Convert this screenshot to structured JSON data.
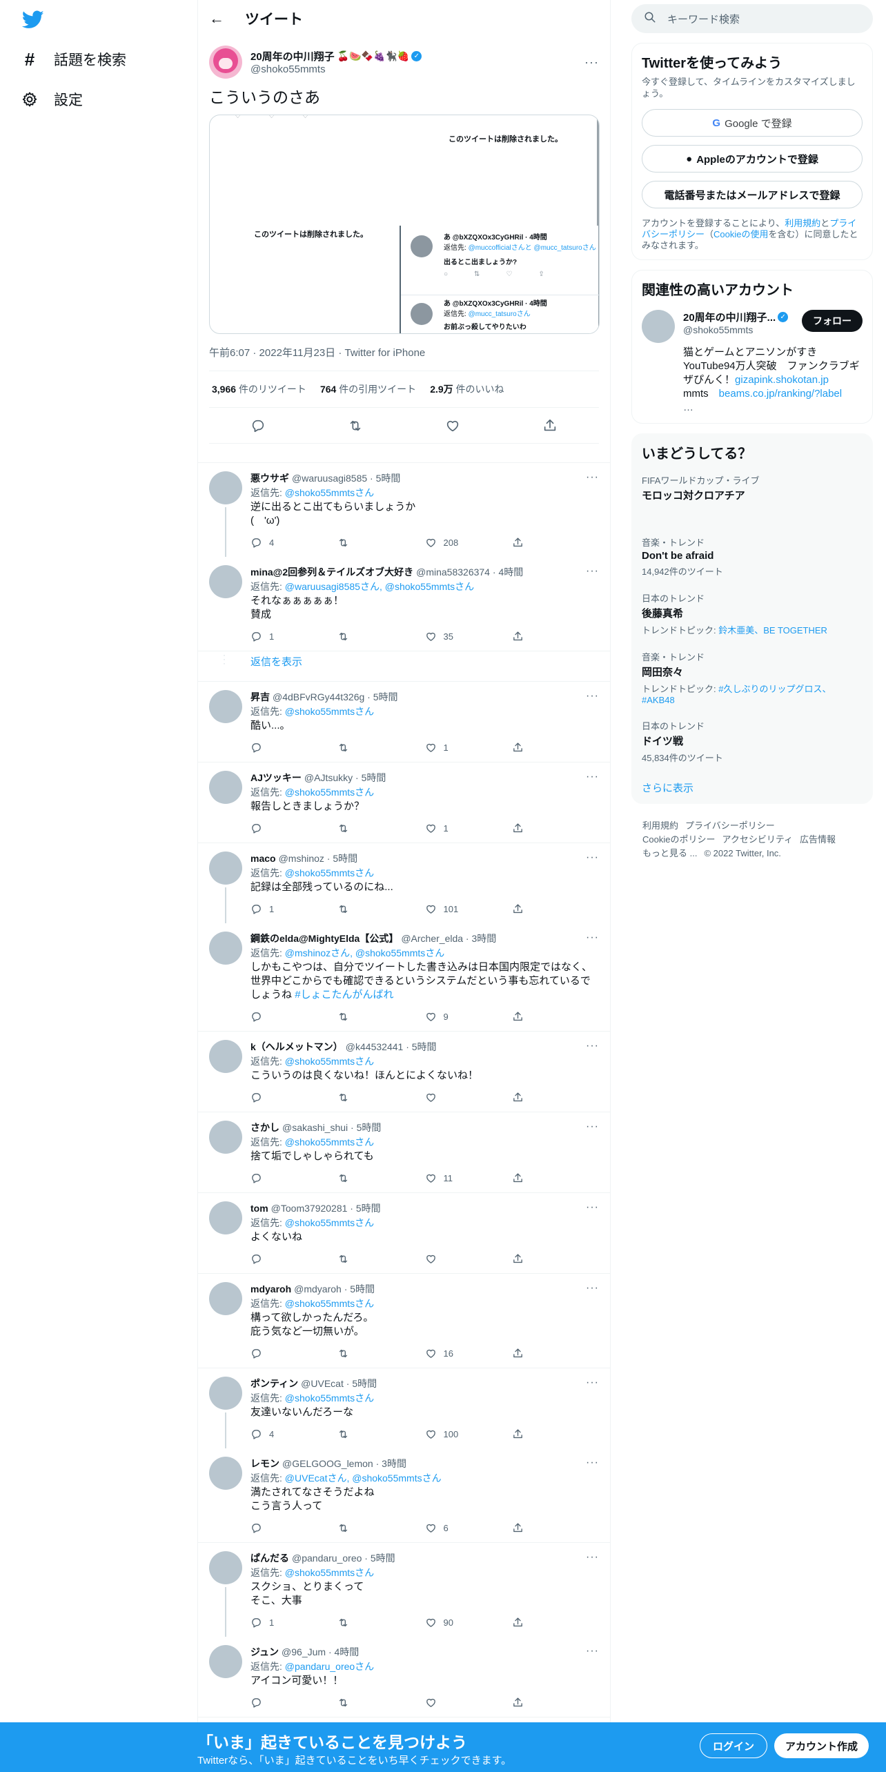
{
  "nav": {
    "explore_label": "話題を検索",
    "settings_label": "設定"
  },
  "header": {
    "title": "ツイート"
  },
  "tweet": {
    "author_name": "20周年の中川翔子",
    "author_emojis": "🍒🍉🍫🍇🐈‍⬛🍓",
    "author_handle": "@shoko55mmts",
    "text": "こういうのさあ",
    "media": {
      "deleted_1": "このツイートは削除されました。",
      "deleted_2": "このツイートは削除されました。",
      "nested": [
        {
          "header": "あ @bXZQXOx3CyGHRil · 4時間",
          "to_prefix": "返信先: ",
          "to": "@muccofficialさんと @mucc_tatsuroさん",
          "text": "出るとこ出ましょうか?"
        },
        {
          "header": "あ @bXZQXOx3CyGHRil · 4時間",
          "to_prefix": "返信先: ",
          "to": "@mucc_tatsuroさん",
          "text": "お前ぶっ殺してやりたいわ"
        }
      ]
    },
    "time": "午前6:07",
    "date": "2022年11月23日",
    "source": "Twitter for iPhone",
    "retweets": "3,966",
    "retweets_label": "件のリツイート",
    "quotes": "764",
    "quotes_label": "件の引用ツイート",
    "likes": "2.9万",
    "likes_label": "件のいいね"
  },
  "replies": [
    {
      "name": "悪ウサギ",
      "handle": "@waruusagi8585",
      "time": "5時間",
      "to": "@shoko55mmtsさん",
      "text": "逆に出るとこ出てもらいましょうか\n(　'ω')",
      "replies": "4",
      "retweets": "",
      "likes": "208",
      "chain": true
    },
    {
      "name": "mina@2回参列＆テイルズオブ大好き",
      "handle": "@mina58326374",
      "time": "4時間",
      "to": "@waruusagi8585さん, @shoko55mmtsさん",
      "text": "それなぁぁぁぁぁ！\n賛成",
      "replies": "1",
      "retweets": "",
      "likes": "35",
      "chain": false
    },
    {
      "name": "昇吉",
      "handle": "@4dBFvRGy44t326g",
      "time": "5時間",
      "to": "@shoko55mmtsさん",
      "text": "酷い...。",
      "replies": "",
      "retweets": "",
      "likes": "1",
      "chain": false
    },
    {
      "name": "AJツッキー",
      "handle": "@AJtsukky",
      "time": "5時間",
      "to": "@shoko55mmtsさん",
      "text": "報告しときましょうか？",
      "replies": "",
      "retweets": "",
      "likes": "1",
      "chain": false
    },
    {
      "name": "maco",
      "handle": "@mshinoz",
      "time": "5時間",
      "to": "@shoko55mmtsさん",
      "text": "記録は全部残っているのにね...",
      "replies": "1",
      "retweets": "",
      "likes": "101",
      "chain": true
    },
    {
      "name": "鋼鉄のelda@MightyElda【公式】",
      "handle": "@Archer_elda",
      "time": "3時間",
      "to": "@mshinozさん, @shoko55mmtsさん",
      "text": "しかもこやつは、自分でツイートした書き込みは日本国内限定ではなく、世界中どこからでも確認できるというシステムだという事も忘れているでしょうね",
      "hashtag": "#しょこたんがんばれ",
      "replies": "",
      "retweets": "",
      "likes": "9",
      "chain": false
    },
    {
      "name": "k（ヘルメットマン）",
      "handle": "@k44532441",
      "time": "5時間",
      "to": "@shoko55mmtsさん",
      "text": "こういうのは良くないね！ほんとによくないね！",
      "replies": "",
      "retweets": "",
      "likes": "",
      "chain": false
    },
    {
      "name": "さかし",
      "handle": "@sakashi_shui",
      "time": "5時間",
      "to": "@shoko55mmtsさん",
      "text": "捨て垢でしゃしゃられても",
      "replies": "",
      "retweets": "",
      "likes": "11",
      "chain": false
    },
    {
      "name": "tom",
      "handle": "@Toom37920281",
      "time": "5時間",
      "to": "@shoko55mmtsさん",
      "text": "よくないね",
      "replies": "",
      "retweets": "",
      "likes": "",
      "chain": false
    },
    {
      "name": "mdyaroh",
      "handle": "@mdyaroh",
      "time": "5時間",
      "to": "@shoko55mmtsさん",
      "text": "構って欲しかったんだろ。\n庇う気など一切無いが。",
      "replies": "",
      "retweets": "",
      "likes": "16",
      "chain": false
    },
    {
      "name": "ポンティン",
      "handle": "@UVEcat",
      "time": "5時間",
      "to": "@shoko55mmtsさん",
      "text": "友達いないんだろーな",
      "replies": "4",
      "retweets": "",
      "likes": "100",
      "chain": true
    },
    {
      "name": "レモン",
      "handle": "@GELGOOG_lemon",
      "time": "3時間",
      "to": "@UVEcatさん, @shoko55mmtsさん",
      "text": "満たされてなさそうだよね\nこう言う人って",
      "replies": "",
      "retweets": "",
      "likes": "6",
      "chain": false
    },
    {
      "name": "ぱんだる",
      "handle": "@pandaru_oreo",
      "time": "5時間",
      "to": "@shoko55mmtsさん",
      "text": "スクショ、とりまくって\nそこ、大事",
      "replies": "1",
      "retweets": "",
      "likes": "90",
      "chain": true
    },
    {
      "name": "ジュン",
      "handle": "@96_Jum",
      "time": "4時間",
      "to": "@pandaru_oreoさん",
      "text": "アイコン可愛い！！",
      "replies": "",
      "retweets": "",
      "likes": "",
      "chain": false
    }
  ],
  "reply_to_prefix": "返信先: ",
  "show_replies_label": "返信を表示",
  "sidebar": {
    "search_placeholder": "キーワード検索",
    "signup": {
      "title": "Twitterを使ってみよう",
      "subtitle": "今すぐ登録して、タイムラインをカスタマイズしましょう。",
      "google_button": "Google で登録",
      "apple_button": "Appleのアカウントで登録",
      "phone_button": "電話番号またはメールアドレスで登録",
      "terms_prefix": "アカウントを登録することにより、",
      "terms_link": "利用規約",
      "terms_and": "と",
      "privacy_link": "プライバシーポリシー",
      "cookie_open": "（",
      "cookie_link": "Cookieの使用",
      "cookie_close": "を含む）に同意したとみなされます。"
    },
    "accounts": {
      "title": "関連性の高いアカウント",
      "name": "20周年の中川翔子...",
      "handle": "@shoko55mmts",
      "follow": "フォロー",
      "bio": "猫とゲームとアニソンがすき　YouTube94万人突破　ファンクラブギザぴんく！",
      "bio_link1": "gizapink.shokotan.jp",
      "bio_text2": "mmts　",
      "bio_link2": "beams.co.jp/ranking/?label",
      "bio_ellipsis": "…"
    },
    "trends": {
      "title": "いまどうしてる？",
      "items": [
        {
          "category": "FIFAワールドカップ・ライブ",
          "name": "モロッコ対クロアチア",
          "sub": ""
        },
        {
          "category": "音楽・トレンド",
          "name": "Don't be afraid",
          "sub": "14,942件のツイート"
        },
        {
          "category": "日本のトレンド",
          "name": "後藤真希",
          "sub_prefix": "トレンドトピック: ",
          "sub_link": "鈴木亜美、BE TOGETHER"
        },
        {
          "category": "音楽・トレンド",
          "name": "岡田奈々",
          "sub_prefix": "トレンドトピック: ",
          "sub_link": "#久しぶりのリップグロス、#AKB48"
        },
        {
          "category": "日本のトレンド",
          "name": "ドイツ戦",
          "sub": "45,834件のツイート"
        }
      ],
      "show_more": "さらに表示"
    },
    "footer": {
      "line1": [
        "利用規約",
        "プライバシーポリシー"
      ],
      "line2": [
        "Cookieのポリシー",
        "アクセシビリティ",
        "広告情報"
      ],
      "line3": [
        "もっと見る ...",
        "© 2022 Twitter, Inc."
      ]
    }
  },
  "bottom_bar": {
    "title": "「いま」起きていることを見つけよう",
    "subtitle": "Twitterなら、「いま」起きていることをいち早くチェックできます。",
    "login": "ログイン",
    "signup": "アカウント作成"
  },
  "colors": {
    "accent": "#1d9bf0",
    "text": "#0f1419",
    "muted": "#536471"
  }
}
